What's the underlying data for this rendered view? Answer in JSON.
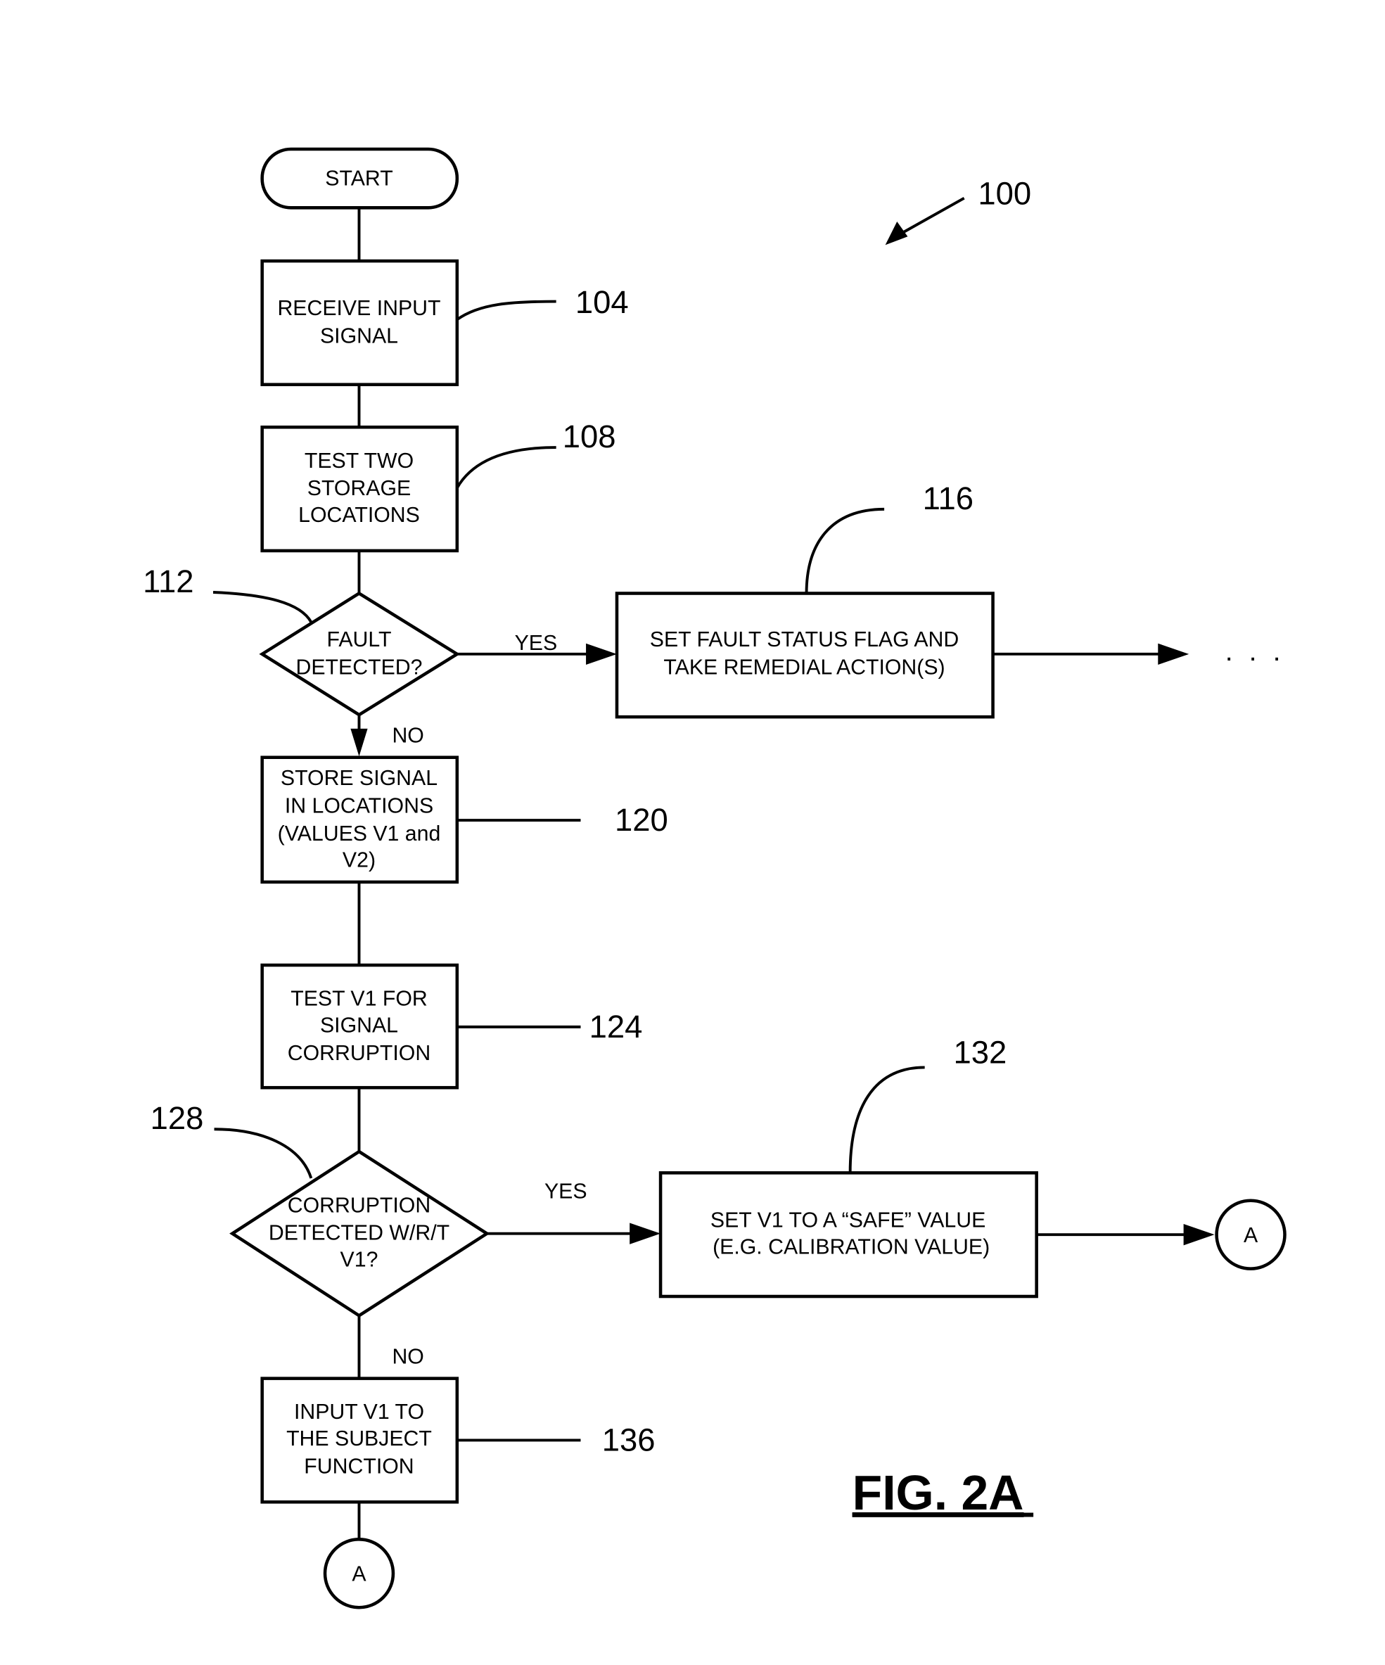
{
  "figure": {
    "label": "FIG. 2A",
    "reference": "100"
  },
  "nodes": {
    "start": {
      "type": "terminal",
      "lines": [
        "START"
      ]
    },
    "n104": {
      "type": "process",
      "ref": "104",
      "lines": [
        "RECEIVE INPUT",
        "SIGNAL"
      ]
    },
    "n108": {
      "type": "process",
      "ref": "108",
      "lines": [
        "TEST TWO",
        "STORAGE",
        "LOCATIONS"
      ]
    },
    "n112": {
      "type": "decision",
      "ref": "112",
      "lines": [
        "FAULT",
        "DETECTED?"
      ]
    },
    "n116": {
      "type": "process",
      "ref": "116",
      "lines": [
        "SET FAULT STATUS FLAG AND",
        "TAKE REMEDIAL ACTION(S)"
      ]
    },
    "n120": {
      "type": "process",
      "ref": "120",
      "lines": [
        "STORE SIGNAL",
        "IN LOCATIONS",
        "(VALUES V1 and",
        "V2)"
      ]
    },
    "n124": {
      "type": "process",
      "ref": "124",
      "lines": [
        "TEST V1 FOR",
        "SIGNAL",
        "CORRUPTION"
      ]
    },
    "n128": {
      "type": "decision",
      "ref": "128",
      "lines": [
        "CORRUPTION",
        "DETECTED W/R/T",
        "V1?"
      ]
    },
    "n132": {
      "type": "process",
      "ref": "132",
      "lines": [
        "SET V1 TO A “SAFE” VALUE",
        "(E.G. CALIBRATION VALUE)"
      ]
    },
    "n136": {
      "type": "process",
      "ref": "136",
      "lines": [
        "INPUT V1 TO",
        "THE SUBJECT",
        "FUNCTION"
      ]
    },
    "connA_right": {
      "type": "connector",
      "lines": [
        "A"
      ]
    },
    "connA_bottom": {
      "type": "connector",
      "lines": [
        "A"
      ]
    }
  },
  "edges": {
    "fault_yes": "YES",
    "fault_no": "NO",
    "corruption_yes": "YES",
    "corruption_no": "NO",
    "continuation": ". . ."
  }
}
